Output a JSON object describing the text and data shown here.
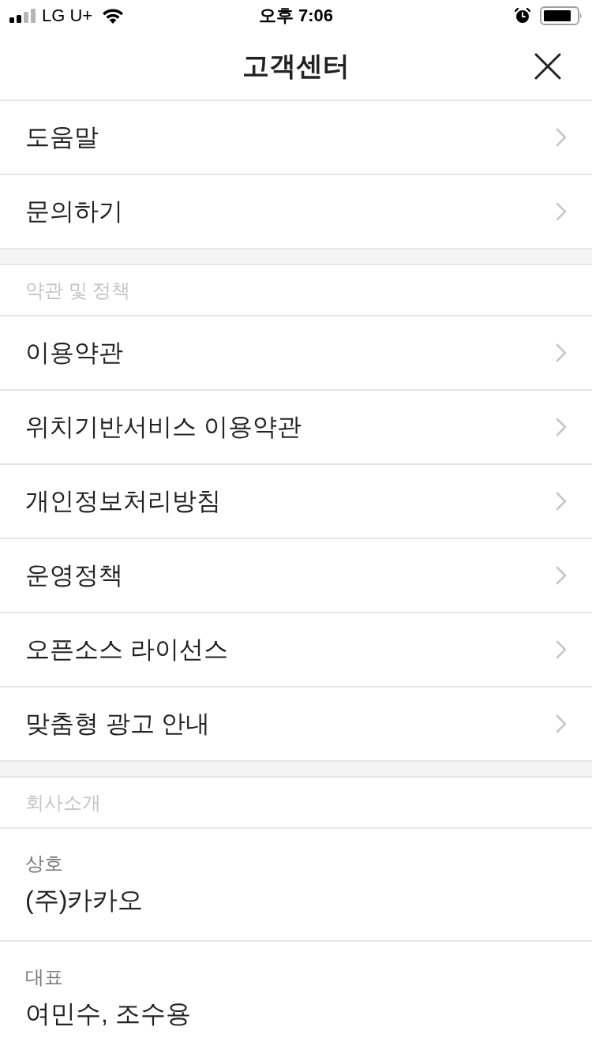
{
  "status_bar": {
    "carrier": "LG U+",
    "time": "오후 7:06"
  },
  "header": {
    "title": "고객센터"
  },
  "menu_groups": [
    {
      "items": [
        {
          "label": "도움말"
        },
        {
          "label": "문의하기"
        }
      ]
    },
    {
      "heading": "약관 및 정책",
      "items": [
        {
          "label": "이용약관"
        },
        {
          "label": "위치기반서비스 이용약관"
        },
        {
          "label": "개인정보처리방침"
        },
        {
          "label": "운영정책"
        },
        {
          "label": "오픈소스 라이선스"
        },
        {
          "label": "맞춤형 광고 안내"
        }
      ]
    }
  ],
  "company": {
    "heading": "회사소개",
    "fields": [
      {
        "label": "상호",
        "value": "(주)카카오"
      },
      {
        "label": "대표",
        "value": "여민수, 조수용"
      }
    ]
  }
}
